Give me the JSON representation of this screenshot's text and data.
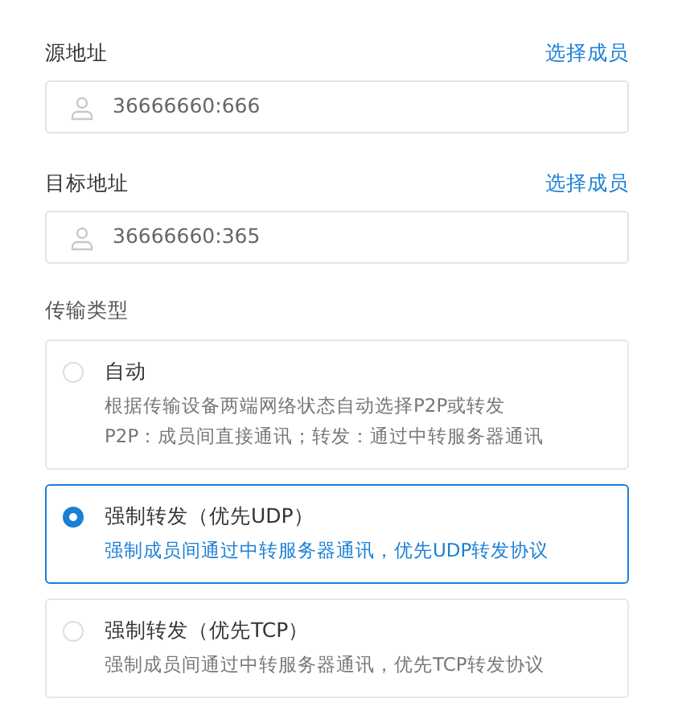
{
  "fields": [
    {
      "label": "源地址",
      "action": "选择成员",
      "value": "36666660:666"
    },
    {
      "label": "目标地址",
      "action": "选择成员",
      "value": "36666660:365"
    }
  ],
  "transfer_type": {
    "label": "传输类型",
    "options": [
      {
        "title": "自动",
        "description": [
          "根据传输设备两端网络状态自动选择P2P或转发",
          "P2P：成员间直接通讯；转发：通过中转服务器通讯"
        ],
        "selected": false
      },
      {
        "title": "强制转发（优先UDP）",
        "description": [
          "强制成员间通过中转服务器通讯，优先UDP转发协议"
        ],
        "selected": true
      },
      {
        "title": "强制转发（优先TCP）",
        "description": [
          "强制成员间通过中转服务器通讯，优先TCP转发协议"
        ],
        "selected": false
      }
    ]
  }
}
